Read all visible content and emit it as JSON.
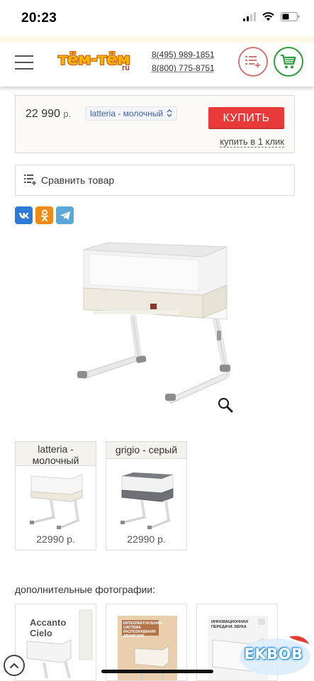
{
  "status_bar": {
    "time": "20:23"
  },
  "header": {
    "logo_text": "тём-тём",
    "logo_suffix": "ru",
    "phones": [
      "8(495) 989-1851",
      "8(800) 775-8751"
    ]
  },
  "buy_box": {
    "price": "22 990",
    "currency": "р.",
    "variant_selected": "latteria - молочный",
    "buy_label": "КУПИТЬ",
    "one_click_label": "купить в 1 клик"
  },
  "compare": {
    "label": "Сравнить товар"
  },
  "social": {
    "vk": "vk",
    "ok": "ok",
    "telegram": "telegram"
  },
  "variants": [
    {
      "name": "latteria - молочный",
      "price": "22990 р.",
      "frame_color": "#ece8dc"
    },
    {
      "name": "grigio - серый",
      "price": "22990 р.",
      "frame_color": "#6e7075"
    }
  ],
  "extra_photos": {
    "title": "дополнительные фотографии:",
    "items": [
      {
        "caption_line1": "Accanto",
        "caption_line2": "Cielo"
      },
      {
        "caption": "ИНТЕЛЛЕКТУАЛЬНАЯ СИСТЕМА РАСПОЗНАВАНИЯ ДВИЖЕНИЯ"
      },
      {
        "caption": "ИННОВАЦИОННАЯ ПЕРЕДАЧА ЗВУКА"
      }
    ]
  },
  "watermark": {
    "text": "EKBOB"
  },
  "colors": {
    "buy": "#e93a3a",
    "cart": "#2f9d3e",
    "compare_circle": "#d47777",
    "link": "#3d5fae"
  }
}
